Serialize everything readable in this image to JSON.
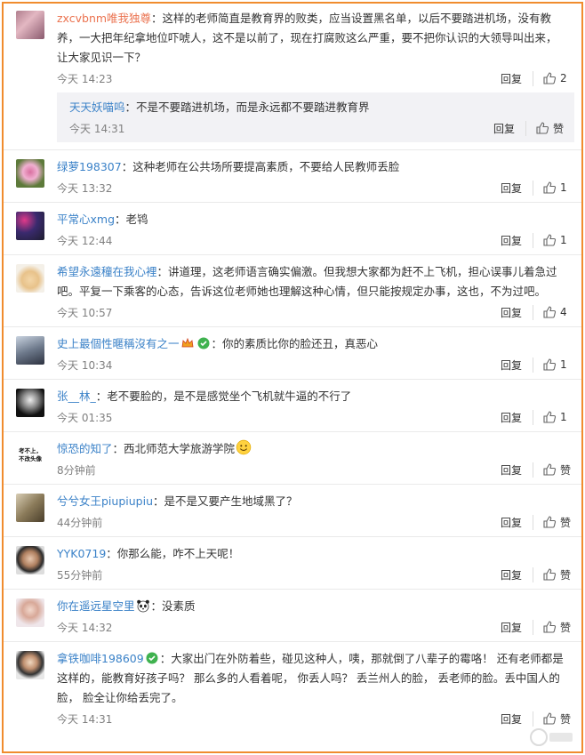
{
  "comments": [
    {
      "user": "zxcvbnm唯我独尊",
      "text": "：这样的老师简直是教育界的败类，应当设置黑名单，以后不要踏进机场，没有教养，一大把年纪拿地位吓唬人，这不是以前了，现在打腐败这么严重，要不把你认识的大领导叫出来，让大家见识一下？",
      "time": "今天 14:23",
      "reply": "回复",
      "likes": "2",
      "sub": {
        "user": "天天妖喵呜",
        "text": "：不是不要踏进机场，而是永远都不要踏进教育界",
        "time": "今天 14:31",
        "reply": "回复",
        "likes": "赞"
      }
    },
    {
      "user": "绿萝198307",
      "text": "：这种老师在公共场所要提高素质，不要给人民教师丢脸",
      "time": "今天 13:32",
      "reply": "回复",
      "likes": "1"
    },
    {
      "user": "平常心xmg",
      "text": "：老鸨",
      "time": "今天 12:44",
      "reply": "回复",
      "likes": "1"
    },
    {
      "user": "希望永遠穜在我心裡",
      "text": "：讲道理，这老师语言确实偏激。但我想大家都为赶不上飞机，担心误事儿着急过吧。平复一下乘客的心态，告诉这位老师她也理解这种心情，但只能按规定办事，这也，不为过吧。",
      "time": "今天 10:57",
      "reply": "回复",
      "likes": "4"
    },
    {
      "user": "史上最個性暱稱沒有之一",
      "text": "：你的素质比你的脸还丑，真恶心",
      "time": "今天 10:34",
      "reply": "回复",
      "likes": "1"
    },
    {
      "user": "张__林_",
      "text": "：老不要脸的，是不是感觉坐个飞机就牛逼的不行了",
      "time": "今天 01:35",
      "reply": "回复",
      "likes": "1"
    },
    {
      "user": "惊恐的知了",
      "text": "：西北师范大学旅游学院",
      "time": "8分钟前",
      "reply": "回复",
      "likes": "赞",
      "avatar_text": [
        "考不上，",
        "不改头像"
      ]
    },
    {
      "user": "兮兮女王piupiupiu",
      "text": "：是不是又要产生地域黑了？",
      "time": "44分钟前",
      "reply": "回复",
      "likes": "赞"
    },
    {
      "user": "YYK0719",
      "text": "：你那么能，咋不上天呢！",
      "time": "55分钟前",
      "reply": "回复",
      "likes": "赞"
    },
    {
      "user": "你在遥远星空里",
      "text": "：没素质",
      "time": "今天 14:32",
      "reply": "回复",
      "likes": "赞"
    },
    {
      "user": "拿铁咖啡198609",
      "text": "：大家出门在外防着些，碰见这种人，咦，那就倒了八辈子的霉咯！ 还有老师都是这样的，能教育好孩子吗？ 那么多的人看着呢， 你丢人吗？ 丢兰州人的脸， 丢老师的脸。丢中国人的脸， 脸全让你给丢完了。",
      "time": "今天 14:31",
      "reply": "回复",
      "likes": "赞"
    }
  ],
  "colors": {
    "accent_border": "#f08c2e",
    "username": "#eb7350",
    "reply_username": "#3b82c8"
  }
}
